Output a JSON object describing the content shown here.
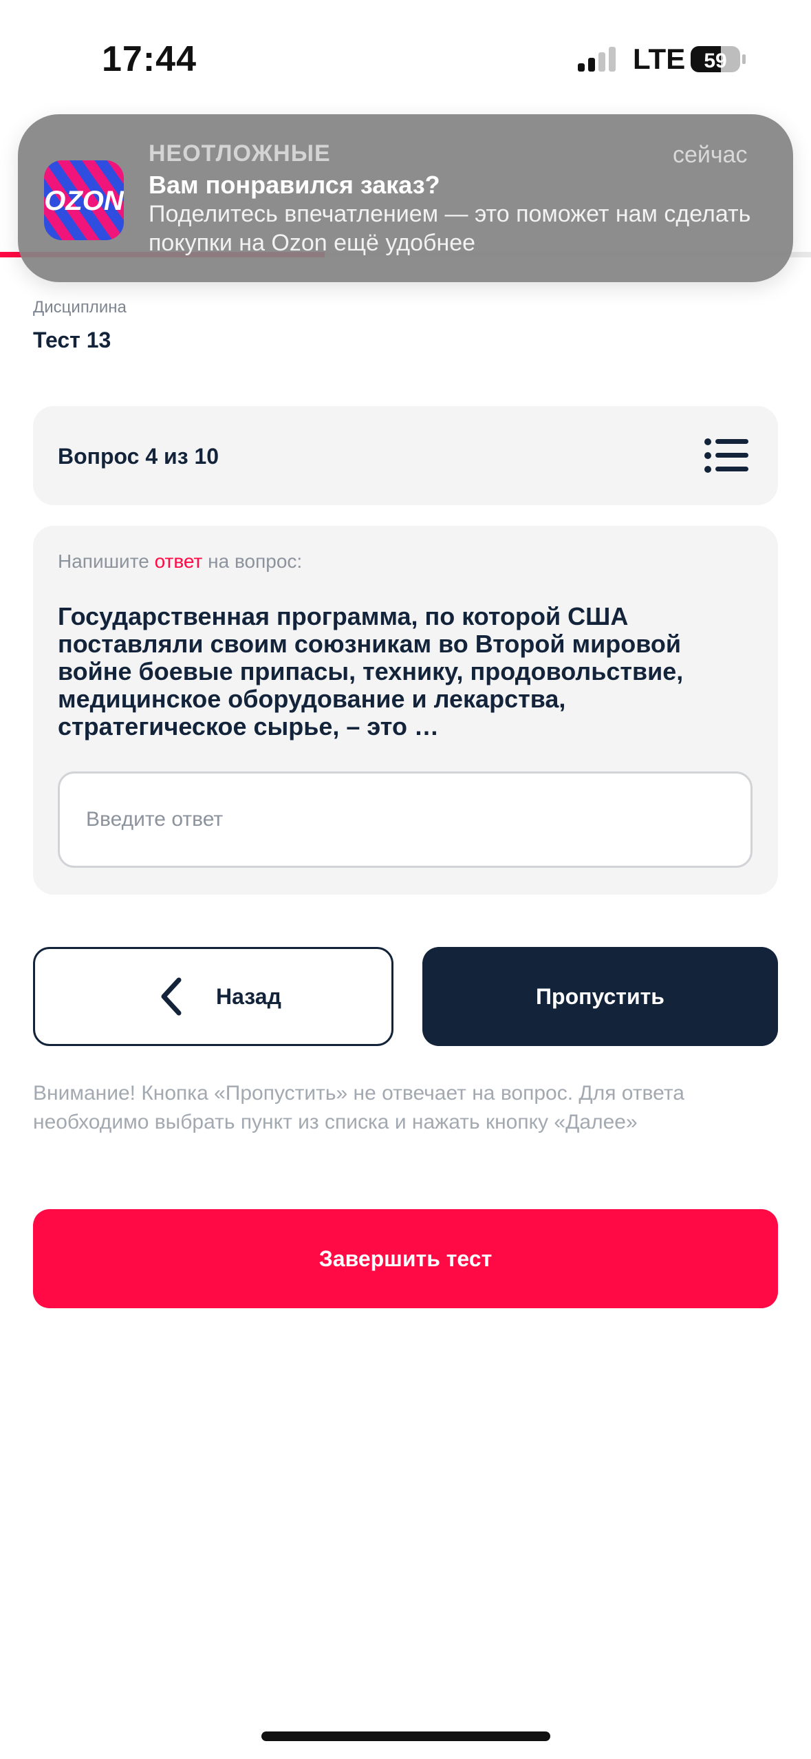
{
  "status_bar": {
    "time": "17:44",
    "network": "LTE",
    "battery": "59",
    "signal_bars": 2
  },
  "progress": {
    "fraction": 0.4
  },
  "notification": {
    "app_icon": "ozon-app-icon",
    "app_logo_text": "OZON",
    "category": "НЕОТЛОЖНЫЕ",
    "time": "сейчас",
    "title": "Вам понравился заказ?",
    "body": "Поделитесь впечатлением — это поможет нам сделать покупки на Ozon ещё удобнее"
  },
  "discipline": {
    "label": "Дисциплина",
    "value": "Тест 13"
  },
  "question_counter": {
    "text": "Вопрос 4 из 10",
    "icon": "list-icon"
  },
  "question": {
    "prompt_before": "Напишите ",
    "prompt_accent": "ответ",
    "prompt_after": " на вопрос:",
    "text": "Государственная программа, по которой США поставляли своим союзникам во Второй мировой войне боевые припасы, технику, продовольствие, медицинское оборудование и лекарства, стратегическое сырье, – это …",
    "answer_value": "",
    "answer_placeholder": "Введите ответ"
  },
  "buttons": {
    "back_label": "Назад",
    "skip_label": "Пропустить",
    "finish_label": "Завершить тест"
  },
  "warning": "Внимание! Кнопка «Пропустить» не отвечает на вопрос. Для ответа необходимо выбрать пункт из списка и нажать кнопку «Далее»",
  "colors": {
    "accent": "#ff0a44",
    "dark": "#13233a",
    "card_bg": "#f4f4f5",
    "muted": "#8c939c"
  }
}
